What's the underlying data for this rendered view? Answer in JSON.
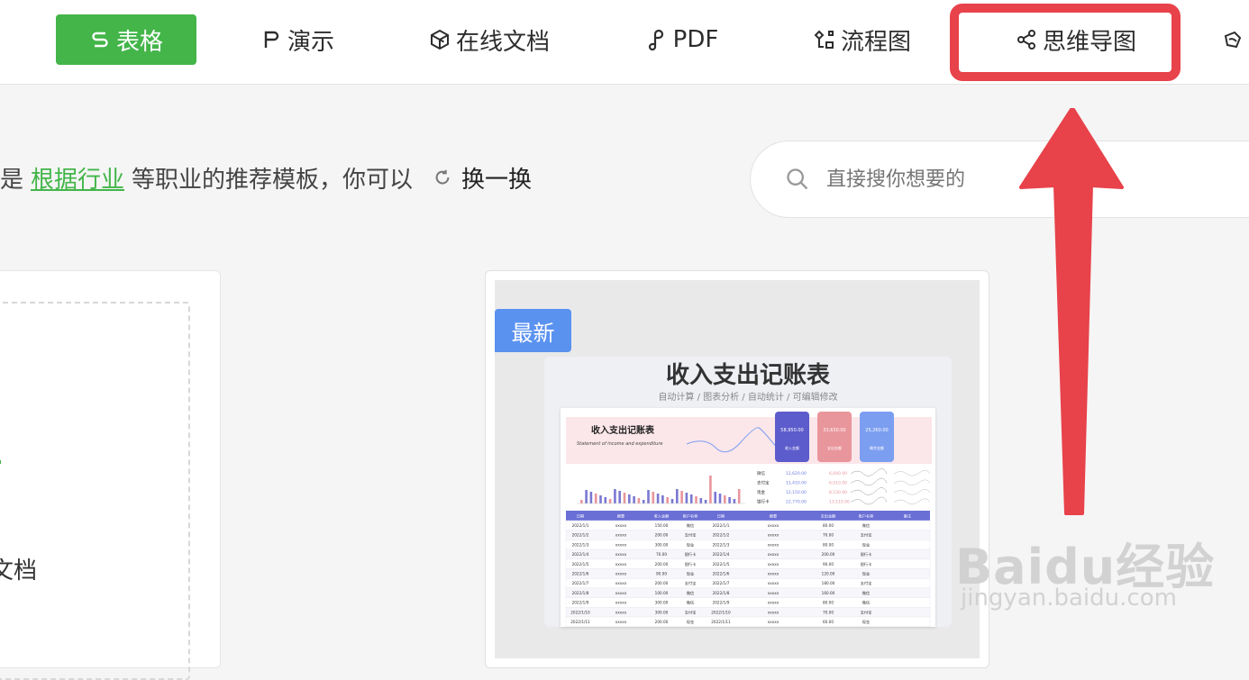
{
  "nav": {
    "tabs": [
      {
        "label": "表格",
        "icon": "sheet-icon",
        "active": true
      },
      {
        "label": "演示",
        "icon": "presentation-icon"
      },
      {
        "label": "在线文档",
        "icon": "online-doc-icon"
      },
      {
        "label": "PDF",
        "icon": "pdf-icon"
      },
      {
        "label": "流程图",
        "icon": "flowchart-icon"
      },
      {
        "label": "思维导图",
        "icon": "mindmap-icon"
      }
    ],
    "active_color": "#43b549",
    "highlight_color": "#e8424a"
  },
  "recommend": {
    "prefix": "是",
    "link": "根据行业",
    "suffix": "等职业的推荐模板，你可以",
    "refresh_label": "换一换"
  },
  "search": {
    "placeholder": "直接搜你想要的"
  },
  "left_card": {
    "label": "文档"
  },
  "template_card": {
    "badge": "最新",
    "badge_color": "#5a92f0",
    "title": "收入支出记账表",
    "subtitle": "自动计算 / 图表分析 / 自动统计 / 可编辑修改",
    "sheet": {
      "header_title": "收入支出记账表",
      "header_sub": "Statement of income and expenditure",
      "stats": [
        {
          "value": "58,950.00",
          "label": "收入金额",
          "color": "#5d5ccc"
        },
        {
          "value": "33,630.00",
          "label": "支出金额",
          "color": "#e9959c"
        },
        {
          "value": "25,260.00",
          "label": "剩余金额",
          "color": "#7b9ef0"
        }
      ],
      "accounts": [
        {
          "name": "微信",
          "income": "12,620.00",
          "expense": "6,040.00"
        },
        {
          "name": "支付宝",
          "income": "11,410.00",
          "expense": "6,010.00"
        },
        {
          "name": "现金",
          "income": "12,150.00",
          "expense": "8,530.00"
        },
        {
          "name": "银行卡",
          "income": "22,770.00",
          "expense": "13,110.00"
        }
      ],
      "columns": [
        "日期",
        "摘要",
        "收入金额",
        "账户名称",
        "日期",
        "摘要",
        "支出金额",
        "账户名称",
        "备注"
      ],
      "rows": [
        [
          "2022/1/1",
          "xxxxx",
          "150.00",
          "微信",
          "2022/1/1",
          "xxxxx",
          "80.00",
          "微信"
        ],
        [
          "2022/1/2",
          "xxxxx",
          "200.00",
          "支付宝",
          "2022/1/2",
          "xxxxx",
          "70.00",
          "支付宝"
        ],
        [
          "2022/1/3",
          "xxxxx",
          "300.00",
          "现金",
          "2022/1/3",
          "xxxxx",
          "80.00",
          "现金"
        ],
        [
          "2022/1/4",
          "xxxxx",
          "70.00",
          "银行卡",
          "2022/1/4",
          "xxxxx",
          "200.00",
          "银行卡"
        ],
        [
          "2022/1/5",
          "xxxxx",
          "200.00",
          "银行卡",
          "2022/1/5",
          "xxxxx",
          "90.00",
          "银行卡"
        ],
        [
          "2022/1/6",
          "xxxxx",
          "90.00",
          "现金",
          "2022/1/6",
          "xxxxx",
          "120.00",
          "现金"
        ],
        [
          "2022/1/7",
          "xxxxx",
          "200.00",
          "支付宝",
          "2022/1/7",
          "xxxxx",
          "180.00",
          "支付宝"
        ],
        [
          "2022/1/8",
          "xxxxx",
          "100.00",
          "微信",
          "2022/1/8",
          "xxxxx",
          "160.00",
          "微信"
        ],
        [
          "2022/1/9",
          "xxxxx",
          "300.00",
          "微信",
          "2022/1/9",
          "xxxxx",
          "80.00",
          "微信"
        ],
        [
          "2022/1/10",
          "xxxxx",
          "300.00",
          "支付宝",
          "2022/1/10",
          "xxxxx",
          "70.00",
          "支付宝"
        ],
        [
          "2022/1/11",
          "xxxxx",
          "200.00",
          "现金",
          "2022/1/11",
          "xxxxx",
          "60.00",
          "现金"
        ]
      ]
    }
  },
  "watermark": {
    "logo": "Baidu经验",
    "url": "jingyan.baidu.com"
  }
}
